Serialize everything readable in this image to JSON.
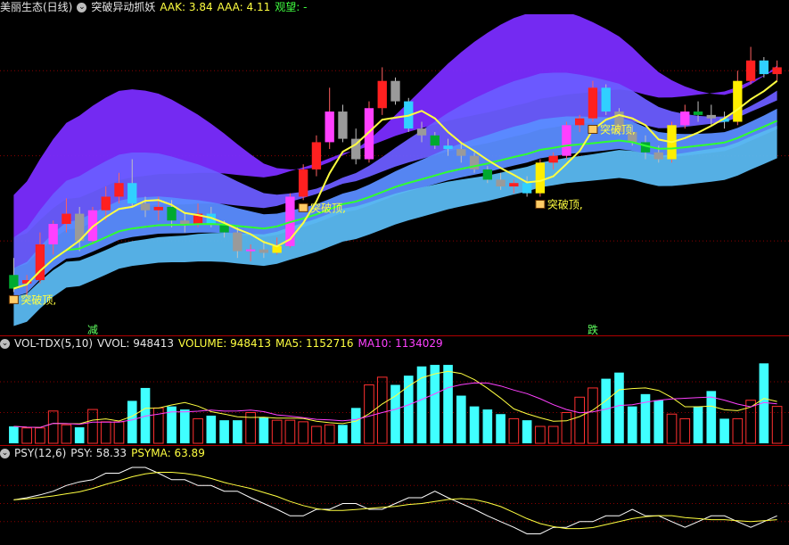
{
  "header1": {
    "stock": "美丽生态(日线)",
    "indicator": "突破异动抓妖",
    "aak": "AAK: 3.84",
    "aaa": "AAA: 4.11",
    "watch": "观望: -"
  },
  "header2": {
    "indicator": "VOL-TDX(5,10)",
    "vvol": "VVOL: 948413",
    "volume": "VOLUME: 948413",
    "ma5": "MA5: 1152716",
    "ma10": "MA10: 1134029"
  },
  "header3": {
    "indicator": "PSY(12,6)",
    "psy": "PSY: 58.33",
    "psyma": "PSYMA: 63.89"
  },
  "annotations": [
    {
      "text": "突破顶,",
      "candle": 0
    },
    {
      "text": "突破顶,",
      "candle": 22
    },
    {
      "text": "突破顶,",
      "candle": 40
    },
    {
      "text": "突破顶,",
      "candle": 44
    }
  ],
  "bottom_marks": [
    {
      "text": "减",
      "candle": 6
    },
    {
      "text": "跌",
      "candle": 44
    }
  ],
  "colors": {
    "up": "#ff3030",
    "down": "#40ffff",
    "ma_green": "#30ff30",
    "ma_yellow": "#ffff40",
    "ma_magenta": "#ff40ff",
    "grid": "#8b0000"
  },
  "chart_data": [
    {
      "type": "candlestick",
      "x": [
        0,
        1,
        2,
        3,
        4,
        5,
        6,
        7,
        8,
        9,
        10,
        11,
        12,
        13,
        14,
        15,
        16,
        17,
        18,
        19,
        20,
        21,
        22,
        23,
        24,
        25,
        26,
        27,
        28,
        29,
        30,
        31,
        32,
        33,
        34,
        35,
        36,
        37,
        38,
        39,
        40,
        41,
        42,
        43,
        44,
        45,
        46,
        47,
        48,
        49,
        50,
        51,
        52,
        53,
        54,
        55,
        56,
        57,
        58
      ],
      "candles": [
        {
          "o": 3.3,
          "h": 3.4,
          "l": 3.2,
          "c": 3.22
        },
        {
          "o": 3.25,
          "h": 3.3,
          "l": 3.18,
          "c": 3.27
        },
        {
          "o": 3.27,
          "h": 3.55,
          "l": 3.25,
          "c": 3.48
        },
        {
          "o": 3.48,
          "h": 3.62,
          "l": 3.42,
          "c": 3.6
        },
        {
          "o": 3.6,
          "h": 3.75,
          "l": 3.55,
          "c": 3.66
        },
        {
          "o": 3.66,
          "h": 3.7,
          "l": 3.44,
          "c": 3.5
        },
        {
          "o": 3.5,
          "h": 3.7,
          "l": 3.48,
          "c": 3.68
        },
        {
          "o": 3.68,
          "h": 3.82,
          "l": 3.62,
          "c": 3.76
        },
        {
          "o": 3.76,
          "h": 3.9,
          "l": 3.72,
          "c": 3.84
        },
        {
          "o": 3.84,
          "h": 3.98,
          "l": 3.7,
          "c": 3.72
        },
        {
          "o": 3.72,
          "h": 3.76,
          "l": 3.64,
          "c": 3.68
        },
        {
          "o": 3.68,
          "h": 3.76,
          "l": 3.62,
          "c": 3.7
        },
        {
          "o": 3.7,
          "h": 3.74,
          "l": 3.58,
          "c": 3.62
        },
        {
          "o": 3.62,
          "h": 3.66,
          "l": 3.55,
          "c": 3.6
        },
        {
          "o": 3.6,
          "h": 3.72,
          "l": 3.58,
          "c": 3.66
        },
        {
          "o": 3.66,
          "h": 3.7,
          "l": 3.58,
          "c": 3.6
        },
        {
          "o": 3.6,
          "h": 3.62,
          "l": 3.52,
          "c": 3.55
        },
        {
          "o": 3.55,
          "h": 3.58,
          "l": 3.4,
          "c": 3.44
        },
        {
          "o": 3.44,
          "h": 3.48,
          "l": 3.38,
          "c": 3.45
        },
        {
          "o": 3.45,
          "h": 3.5,
          "l": 3.4,
          "c": 3.43
        },
        {
          "o": 3.43,
          "h": 3.52,
          "l": 3.42,
          "c": 3.47
        },
        {
          "o": 3.47,
          "h": 3.78,
          "l": 3.46,
          "c": 3.76
        },
        {
          "o": 3.76,
          "h": 3.95,
          "l": 3.74,
          "c": 3.92
        },
        {
          "o": 3.92,
          "h": 4.12,
          "l": 3.88,
          "c": 4.08
        },
        {
          "o": 4.08,
          "h": 4.4,
          "l": 4.04,
          "c": 4.26
        },
        {
          "o": 4.26,
          "h": 4.3,
          "l": 4.08,
          "c": 4.1
        },
        {
          "o": 4.1,
          "h": 4.16,
          "l": 3.95,
          "c": 3.98
        },
        {
          "o": 3.98,
          "h": 4.32,
          "l": 3.96,
          "c": 4.28
        },
        {
          "o": 4.28,
          "h": 4.52,
          "l": 4.24,
          "c": 4.44
        },
        {
          "o": 4.44,
          "h": 4.46,
          "l": 4.3,
          "c": 4.32
        },
        {
          "o": 4.32,
          "h": 4.34,
          "l": 4.14,
          "c": 4.16
        },
        {
          "o": 4.16,
          "h": 4.2,
          "l": 4.08,
          "c": 4.12
        },
        {
          "o": 4.12,
          "h": 4.14,
          "l": 4.04,
          "c": 4.06
        },
        {
          "o": 4.06,
          "h": 4.1,
          "l": 4.0,
          "c": 4.04
        },
        {
          "o": 4.04,
          "h": 4.08,
          "l": 3.96,
          "c": 4.0
        },
        {
          "o": 4.0,
          "h": 4.02,
          "l": 3.9,
          "c": 3.92
        },
        {
          "o": 3.92,
          "h": 3.94,
          "l": 3.84,
          "c": 3.86
        },
        {
          "o": 3.86,
          "h": 3.9,
          "l": 3.8,
          "c": 3.82
        },
        {
          "o": 3.82,
          "h": 3.86,
          "l": 3.78,
          "c": 3.84
        },
        {
          "o": 3.84,
          "h": 3.88,
          "l": 3.76,
          "c": 3.78
        },
        {
          "o": 3.78,
          "h": 3.98,
          "l": 3.76,
          "c": 3.96
        },
        {
          "o": 3.96,
          "h": 4.02,
          "l": 3.92,
          "c": 4.0
        },
        {
          "o": 4.0,
          "h": 4.2,
          "l": 3.98,
          "c": 4.18
        },
        {
          "o": 4.18,
          "h": 4.24,
          "l": 4.14,
          "c": 4.22
        },
        {
          "o": 4.22,
          "h": 4.44,
          "l": 4.2,
          "c": 4.4
        },
        {
          "o": 4.4,
          "h": 4.42,
          "l": 4.24,
          "c": 4.26
        },
        {
          "o": 4.26,
          "h": 4.28,
          "l": 4.12,
          "c": 4.14
        },
        {
          "o": 4.14,
          "h": 4.18,
          "l": 4.06,
          "c": 4.08
        },
        {
          "o": 4.08,
          "h": 4.12,
          "l": 3.98,
          "c": 4.02
        },
        {
          "o": 4.02,
          "h": 4.06,
          "l": 3.96,
          "c": 3.98
        },
        {
          "o": 3.98,
          "h": 4.2,
          "l": 3.96,
          "c": 4.18
        },
        {
          "o": 4.18,
          "h": 4.3,
          "l": 4.16,
          "c": 4.26
        },
        {
          "o": 4.26,
          "h": 4.32,
          "l": 4.2,
          "c": 4.24
        },
        {
          "o": 4.24,
          "h": 4.3,
          "l": 4.18,
          "c": 4.22
        },
        {
          "o": 4.22,
          "h": 4.26,
          "l": 4.16,
          "c": 4.2
        },
        {
          "o": 4.2,
          "h": 4.5,
          "l": 4.18,
          "c": 4.44
        },
        {
          "o": 4.44,
          "h": 4.64,
          "l": 4.42,
          "c": 4.56
        },
        {
          "o": 4.56,
          "h": 4.58,
          "l": 4.46,
          "c": 4.48
        },
        {
          "o": 4.48,
          "h": 4.56,
          "l": 4.44,
          "c": 4.52
        }
      ],
      "ylim": [
        3.05,
        4.8
      ],
      "grid": true
    },
    {
      "type": "bar",
      "name": "VOLUME",
      "values": [
        0.55,
        0.5,
        0.5,
        1.05,
        0.6,
        0.52,
        1.1,
        0.7,
        0.7,
        1.38,
        1.8,
        1.15,
        1.2,
        1.1,
        0.8,
        0.9,
        0.75,
        0.75,
        1.0,
        0.85,
        0.75,
        0.75,
        0.7,
        0.55,
        0.6,
        0.6,
        1.15,
        1.9,
        2.15,
        1.9,
        2.2,
        2.5,
        2.55,
        2.55,
        1.55,
        1.2,
        1.1,
        0.95,
        0.8,
        0.75,
        0.55,
        0.55,
        1.0,
        1.5,
        1.8,
        2.1,
        2.3,
        1.2,
        1.6,
        1.4,
        0.95,
        0.8,
        1.2,
        1.7,
        0.8,
        0.8,
        1.4,
        2.6,
        1.2
      ],
      "ylim": [
        0,
        2.9
      ],
      "grid": true
    },
    {
      "type": "line",
      "name": "PSY",
      "values": [
        55,
        58,
        62,
        67,
        75,
        80,
        83,
        92,
        92,
        100,
        100,
        92,
        83,
        83,
        75,
        75,
        67,
        67,
        58,
        50,
        42,
        33,
        33,
        42,
        42,
        50,
        50,
        42,
        42,
        50,
        58,
        58,
        67,
        58,
        50,
        42,
        33,
        25,
        17,
        8,
        8,
        17,
        17,
        25,
        25,
        33,
        33,
        42,
        33,
        33,
        25,
        17,
        25,
        33,
        33,
        25,
        17,
        25,
        33
      ],
      "ylim": [
        0,
        100
      ],
      "grid": true
    }
  ]
}
